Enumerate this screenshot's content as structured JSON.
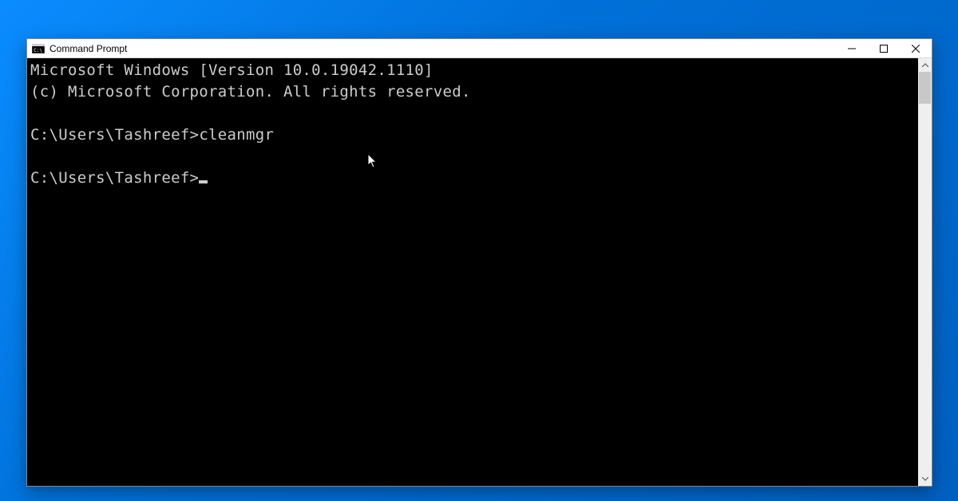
{
  "window": {
    "title": "Command Prompt"
  },
  "console": {
    "line1": "Microsoft Windows [Version 10.0.19042.1110]",
    "line2": "(c) Microsoft Corporation. All rights reserved.",
    "blank1": "",
    "prompt1": "C:\\Users\\Tashreef>",
    "command1": "cleanmgr",
    "blank2": "",
    "prompt2": "C:\\Users\\Tashreef>"
  }
}
